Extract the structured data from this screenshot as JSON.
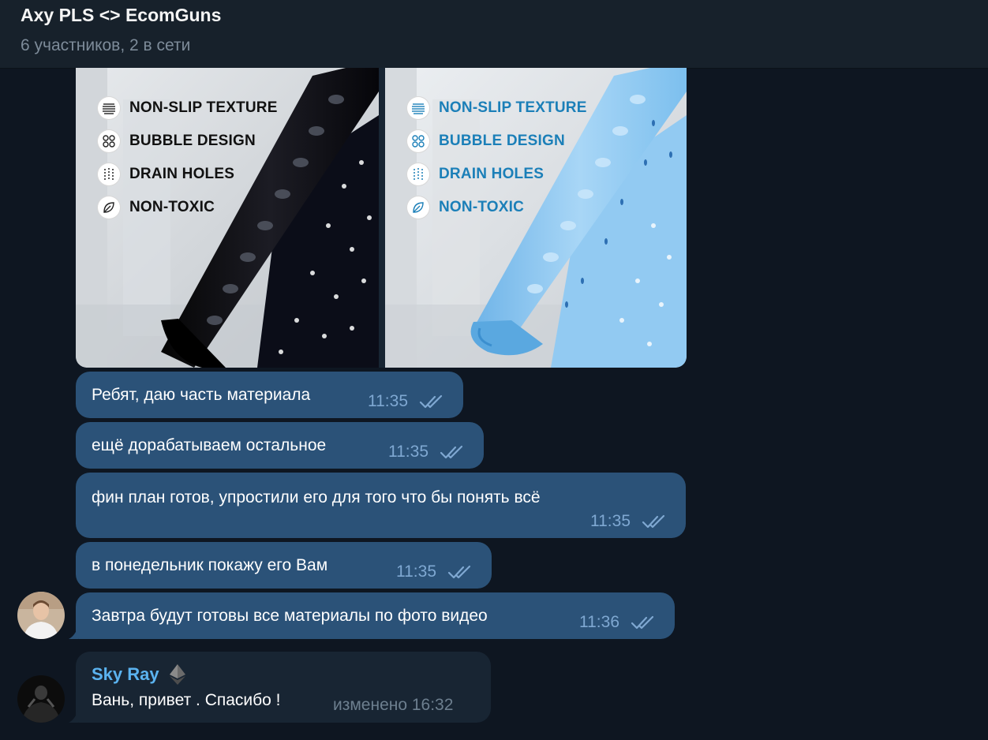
{
  "header": {
    "title": "Axy PLS <> EcomGuns",
    "subtitle": "6 участников, 2 в сети"
  },
  "album": {
    "photos": [
      {
        "name": "black-bath-mat",
        "features": [
          "NON-SLIP TEXTURE",
          "BUBBLE DESIGN",
          "DRAIN HOLES",
          "NON-TOXIC"
        ]
      },
      {
        "name": "blue-bath-mat",
        "features": [
          "NON-SLIP TEXTURE",
          "BUBBLE DESIGN",
          "DRAIN HOLES",
          "NON-TOXIC"
        ]
      }
    ]
  },
  "messages": [
    {
      "text": "Ребят, даю часть материала",
      "time": "11:35",
      "status": "read"
    },
    {
      "text": "ещё дорабатываем остальное",
      "time": "11:35",
      "status": "read"
    },
    {
      "text": "фин план готов, упростили его для того что бы понять всё",
      "time": "11:35",
      "status": "read"
    },
    {
      "text": "в понедельник покажу его Вам",
      "time": "11:35",
      "status": "read"
    },
    {
      "text": "Завтра будут готовы все материалы по фото видео",
      "time": "11:36",
      "status": "read"
    }
  ],
  "incoming": {
    "sender": "Sky Ray",
    "sender_badge": "ethereum-icon",
    "text": "Вань, привет . Спасибо !",
    "meta": "изменено 16:32"
  },
  "colors": {
    "background": "#0e1621",
    "header": "#17212b",
    "outgoing_bubble": "#2b5278",
    "incoming_bubble": "#182533",
    "sender_name": "#5bb3f0",
    "read_ticks": "#7fa8d2"
  }
}
